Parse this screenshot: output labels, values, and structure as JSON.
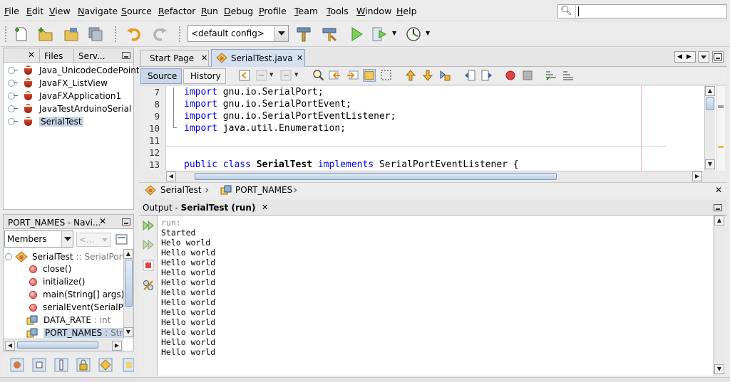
{
  "menu": [
    "File",
    "Edit",
    "View",
    "Navigate",
    "Source",
    "Refactor",
    "Run",
    "Debug",
    "Profile",
    "Team",
    "Tools",
    "Window",
    "Help"
  ],
  "toolbar": {
    "config": "<default config>"
  },
  "left_tabs": [
    "Files",
    "Serv..."
  ],
  "projects": [
    "Java_UnicodeCodePoint",
    "JavaFX_ListView",
    "JavaFXApplication1",
    "JavaTestArduinoSerial",
    "SerialTest"
  ],
  "navigator": {
    "title": "PORT_NAMES - Navi...",
    "filter": "Members",
    "filter2": "<...",
    "root": {
      "name": "SerialTest",
      "type": ":: SerialPort"
    },
    "members": [
      {
        "name": "close()",
        "type": ""
      },
      {
        "name": "initialize()",
        "type": ""
      },
      {
        "name": "main(String[] args)",
        "type": ""
      },
      {
        "name": "serialEvent(SerialPo",
        "type": ""
      },
      {
        "name": "DATA_RATE",
        "type": ": int"
      },
      {
        "name": "PORT_NAMES",
        "type": ": Strin"
      }
    ]
  },
  "editor": {
    "tabs": [
      "Start Page",
      "SerialTest.java"
    ],
    "source_label": "Source",
    "history_label": "History",
    "line_numbers": [
      "7",
      "8",
      "9",
      "10",
      "11",
      "12",
      "13"
    ],
    "breadcrumb": [
      "SerialTest",
      "PORT_NAMES"
    ],
    "code": {
      "l7_kw": "import",
      "l7": " gnu.io.SerialPort;",
      "l8_kw": "import",
      "l8": " gnu.io.SerialPortEvent;",
      "l9_kw": "import",
      "l9": " gnu.io.SerialPortEventListener;",
      "l10_kw": "import",
      "l10": " java.util.Enumeration;",
      "l13_kw1": "public class",
      "l13_name": "SerialTest",
      "l13_kw2": "implements",
      "l13_rest": "SerialPortEventListener {"
    }
  },
  "output": {
    "title_prefix": "Output - ",
    "title_bold": "SerialTest (run)",
    "lines": [
      "run:",
      "Started",
      "Helo world",
      "Hello world",
      "Hello world",
      "Hello world",
      "Hello world",
      "Hello world",
      "Hello world",
      "Hello world",
      "Hello world",
      "Hello world",
      "Hello world",
      "Hello world"
    ]
  }
}
